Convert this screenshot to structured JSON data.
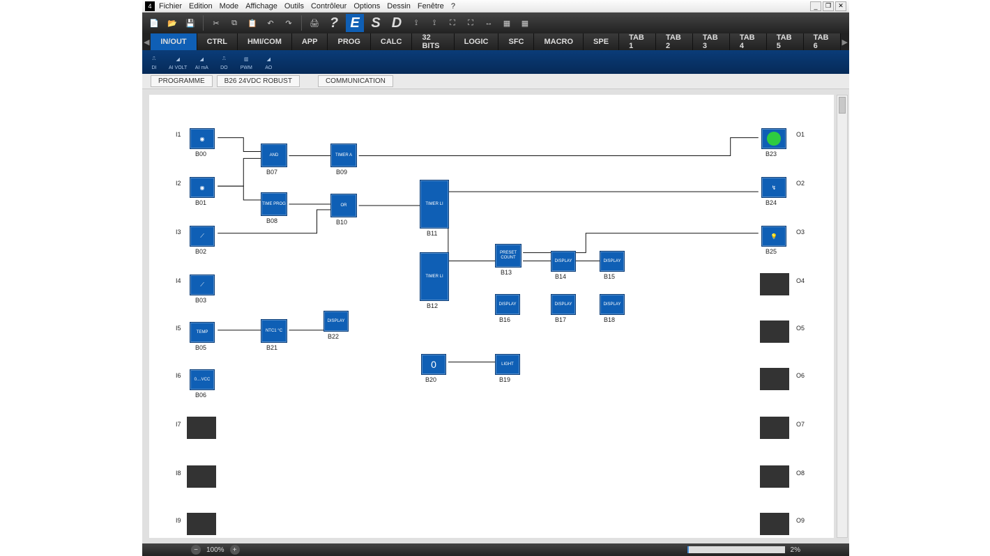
{
  "menu": [
    "Fichier",
    "Edition",
    "Mode",
    "Affichage",
    "Outils",
    "Contrôleur",
    "Options",
    "Dessin",
    "Fenêtre",
    "?"
  ],
  "toolbar_letters": {
    "q": "?",
    "e": "E",
    "s": "S",
    "d": "D"
  },
  "tabs": [
    "IN/OUT",
    "CTRL",
    "HMI/COM",
    "APP",
    "PROG",
    "CALC",
    "32 BITS",
    "LOGIC",
    "SFC",
    "MACRO",
    "SPE",
    "TAB 1",
    "TAB 2",
    "TAB 3",
    "TAB 4",
    "TAB 5",
    "TAB 6"
  ],
  "active_tab": 0,
  "subtool": [
    "DI",
    "AI VOLT",
    "AI mA",
    "DO",
    "PWM",
    "AO"
  ],
  "context_buttons": [
    "PROGRAMME",
    "B26 24VDC ROBUST",
    "COMMUNICATION"
  ],
  "zoom": "100%",
  "progress": "2%",
  "inputs": [
    "I1",
    "I2",
    "I3",
    "I4",
    "I5",
    "I6",
    "I7",
    "I8",
    "I9"
  ],
  "outputs": [
    "O1",
    "O2",
    "O3",
    "O4",
    "O5",
    "O6",
    "O7",
    "O8",
    "O9"
  ],
  "blocks": {
    "B00": "B00",
    "B01": "B01",
    "B02": "B02",
    "B03": "B03",
    "B05": "B05",
    "B06": "B06",
    "B07": "B07",
    "B08": "B08",
    "B09": "B09",
    "B10": "B10",
    "B11": "B11",
    "B12": "B12",
    "B13": "B13",
    "B14": "B14",
    "B15": "B15",
    "B16": "B16",
    "B17": "B17",
    "B18": "B18",
    "B19": "B19",
    "B20": "B20",
    "B21": "B21",
    "B22": "B22",
    "B23": "B23",
    "B24": "B24",
    "B25": "B25"
  },
  "block_text": {
    "and": "AND",
    "timeprog": "TIME\nPROG",
    "timera": "TIMER A",
    "or": "OR",
    "timerli": "TIMER LI",
    "preset": "PRESET\nCOUNT",
    "display": "DISPLAY",
    "light": "LIGHT",
    "temp": "TEMP",
    "ntc": "NTC1\n°C",
    "vcc": "0....VCC",
    "zero": "0"
  }
}
